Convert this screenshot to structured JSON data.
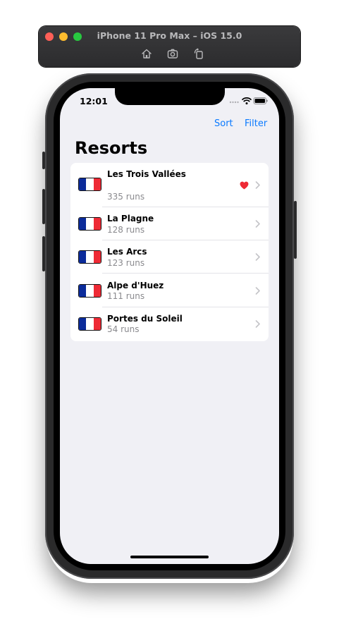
{
  "simulator": {
    "title": "iPhone 11 Pro Max – iOS 15.0",
    "toolbar_icons": [
      "home-icon",
      "screenshot-icon",
      "rotate-icon"
    ]
  },
  "status_bar": {
    "time": "12:01",
    "icons": [
      "cellular-icon",
      "wifi-icon",
      "battery-icon"
    ]
  },
  "nav": {
    "sort_label": "Sort",
    "filter_label": "Filter",
    "title": "Resorts"
  },
  "resorts": [
    {
      "name": "Les Trois Vallées",
      "runs": "335 runs",
      "favorite": true,
      "flag": "france-flag-icon"
    },
    {
      "name": "La Plagne",
      "runs": "128 runs",
      "favorite": false,
      "flag": "france-flag-icon"
    },
    {
      "name": "Les Arcs",
      "runs": "123 runs",
      "favorite": false,
      "flag": "france-flag-icon"
    },
    {
      "name": "Alpe d'Huez",
      "runs": "111 runs",
      "favorite": false,
      "flag": "france-flag-icon"
    },
    {
      "name": "Portes du Soleil",
      "runs": "54 runs",
      "favorite": false,
      "flag": "france-flag-icon"
    }
  ],
  "colors": {
    "accent": "#0a7aff",
    "background": "#f0f0f5",
    "favorite": "#ee2a35",
    "secondary_text": "#8a8a8e"
  }
}
